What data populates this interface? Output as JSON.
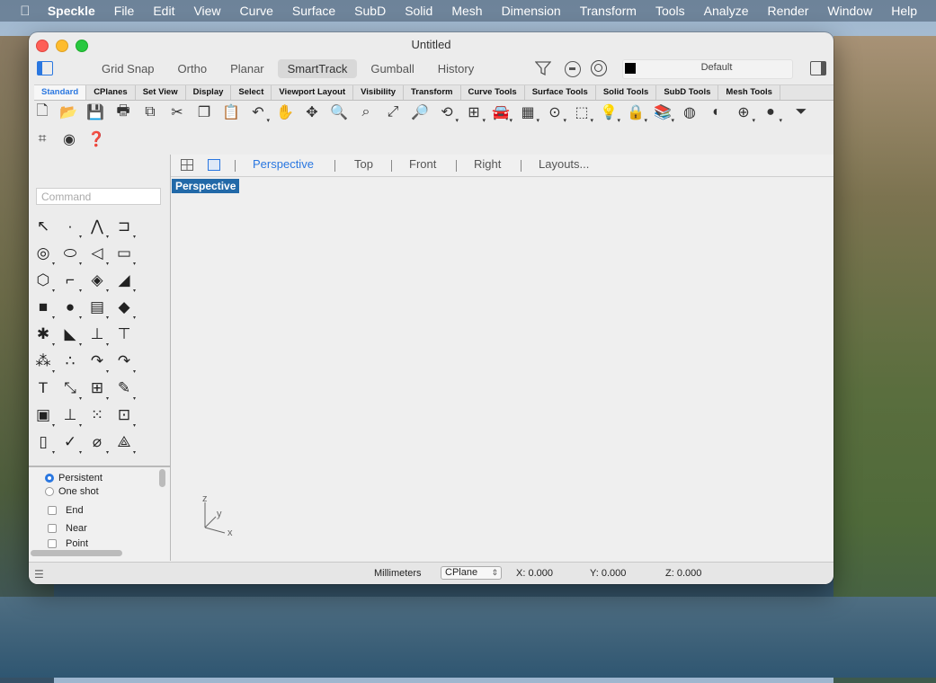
{
  "menubar": {
    "app": "Speckle",
    "items": [
      "File",
      "Edit",
      "View",
      "Curve",
      "Surface",
      "SubD",
      "Solid",
      "Mesh",
      "Dimension",
      "Transform",
      "Tools",
      "Analyze",
      "Render",
      "Window",
      "Help"
    ]
  },
  "window": {
    "title": "Untitled"
  },
  "modes": [
    "Grid Snap",
    "Ortho",
    "Planar",
    "SmartTrack",
    "Gumball",
    "History"
  ],
  "active_mode": "SmartTrack",
  "layer": {
    "name": "Default",
    "color": "#000000"
  },
  "tabs": [
    "Standard",
    "CPlanes",
    "Set View",
    "Display",
    "Select",
    "Viewport Layout",
    "Visibility",
    "Transform",
    "Curve Tools",
    "Surface Tools",
    "Solid Tools",
    "SubD Tools",
    "Mesh Tools"
  ],
  "command": {
    "placeholder": "Command"
  },
  "viewport_tabs": [
    "Perspective",
    "Top",
    "Front",
    "Right",
    "Layouts..."
  ],
  "active_viewport": "Perspective",
  "viewport_label": "Perspective",
  "axes": {
    "z": "z",
    "y": "y",
    "x": "x"
  },
  "osnap": {
    "modes": [
      "Persistent",
      "One shot"
    ],
    "items": [
      "End",
      "Near",
      "Point"
    ]
  },
  "status": {
    "units": "Millimeters",
    "cplane": "CPlane",
    "x": "X: 0.000",
    "y": "Y: 0.000",
    "z": "Z: 0.000"
  }
}
